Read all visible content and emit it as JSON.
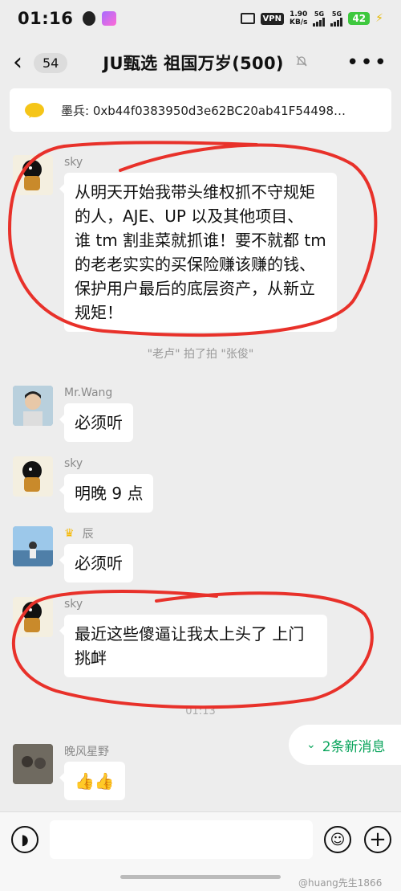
{
  "status_bar": {
    "time": "01:16",
    "vpn": "VPN",
    "speed_value": "1.90",
    "speed_unit": "KB/s",
    "net1": "5G",
    "net2": "5G",
    "battery": "42"
  },
  "header": {
    "back_count": "54",
    "title": "JU甄选 祖国万岁(500)",
    "mute_icon": "bell-off-icon",
    "more_icon": "more-icon"
  },
  "pinned": {
    "text": "墨兵: 0xb44f0383950d3e62BC20ab41F54498…"
  },
  "messages": [
    {
      "sender": "sky",
      "text": [
        "从明天开始我带头维权抓不守规矩",
        "的人，AJE、UP 以及其他项目、",
        "谁 tm 割韭菜就抓谁！要不就都 tm",
        "的老老实实的买保险赚该赚的钱、",
        "保护用户最后的底层资产，从新立",
        "规矩！"
      ]
    },
    {
      "sender": "Mr.Wang",
      "text": [
        "必须听"
      ]
    },
    {
      "sender": "sky",
      "text": [
        "明晚 9 点"
      ]
    },
    {
      "sender": "辰",
      "text": [
        "必须听"
      ]
    },
    {
      "sender": "sky",
      "text": [
        "最近这些傻逼让我太上头了 上门",
        "挑衅"
      ]
    },
    {
      "sender": "晚风星野",
      "text": [
        "👍👍"
      ]
    }
  ],
  "system_note": "\"老卢\" 拍了拍 \"张俊\"",
  "time_note": "01:13",
  "new_messages_label": "2条新消息",
  "input": {
    "placeholder": ""
  },
  "watermark": "@huang先生1866",
  "colors": {
    "annotation_red": "#e8312a",
    "accent_green": "#07a35a"
  }
}
